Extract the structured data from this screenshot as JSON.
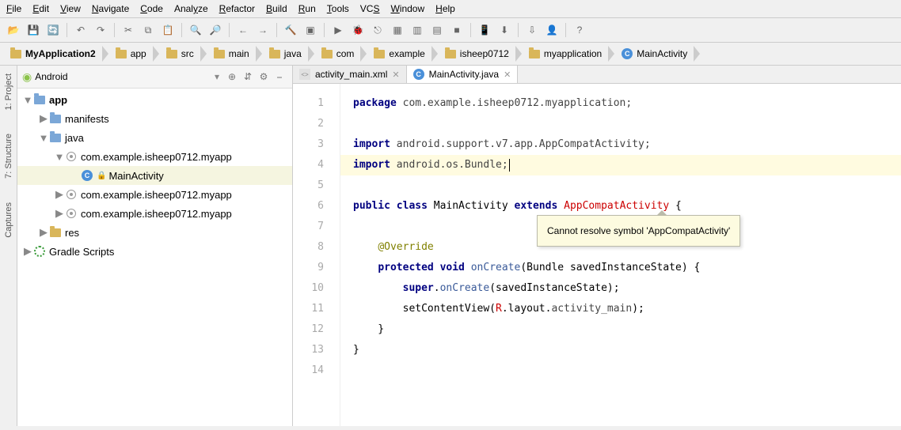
{
  "menu": [
    "File",
    "Edit",
    "View",
    "Navigate",
    "Code",
    "Analyze",
    "Refactor",
    "Build",
    "Run",
    "Tools",
    "VCS",
    "Window",
    "Help"
  ],
  "menu_underline_index": [
    0,
    0,
    0,
    0,
    0,
    4,
    0,
    0,
    0,
    0,
    2,
    0,
    0
  ],
  "breadcrumb": [
    "MyApplication2",
    "app",
    "src",
    "main",
    "java",
    "com",
    "example",
    "isheep0712",
    "myapplication",
    "MainActivity"
  ],
  "sidebar": {
    "selector": "Android",
    "tree": [
      {
        "indent": 0,
        "twisty": "▼",
        "icon": "folder-blue",
        "label": "app",
        "bold": true
      },
      {
        "indent": 1,
        "twisty": "▶",
        "icon": "folder-blue",
        "label": "manifests"
      },
      {
        "indent": 1,
        "twisty": "▼",
        "icon": "folder-blue",
        "label": "java"
      },
      {
        "indent": 2,
        "twisty": "▼",
        "icon": "pkg",
        "label": "com.example.isheep0712.myapp"
      },
      {
        "indent": 3,
        "twisty": "",
        "icon": "class",
        "label": "MainActivity",
        "selected": true,
        "lock": true
      },
      {
        "indent": 2,
        "twisty": "▶",
        "icon": "pkg",
        "label": "com.example.isheep0712.myapp"
      },
      {
        "indent": 2,
        "twisty": "▶",
        "icon": "pkg",
        "label": "com.example.isheep0712.myapp"
      },
      {
        "indent": 1,
        "twisty": "▶",
        "icon": "folder",
        "label": "res"
      },
      {
        "indent": 0,
        "twisty": "▶",
        "icon": "gradle",
        "label": "Gradle Scripts"
      }
    ]
  },
  "left_rail": [
    "1: Project",
    "7: Structure",
    "Captures"
  ],
  "tabs": [
    {
      "icon": "xml",
      "label": "activity_main.xml",
      "active": false
    },
    {
      "icon": "class",
      "label": "MainActivity.java",
      "active": true
    }
  ],
  "code_lines": [
    {
      "n": 1,
      "html": "<span class='kw'>package</span> <span class='pkg'>com.example.isheep0712.myapplication;</span>"
    },
    {
      "n": 2,
      "html": ""
    },
    {
      "n": 3,
      "html": "<span class='kw'>import</span> <span class='pkg'>android.support.v7.app.AppCompatActivity;</span>"
    },
    {
      "n": 4,
      "html": "<span class='kw'>import</span> <span class='pkg'>android.os.Bundle;</span><span class='caret'></span>",
      "hl": true
    },
    {
      "n": 5,
      "html": ""
    },
    {
      "n": 6,
      "html": "<span class='kw'>public class</span> MainActivity <span class='kw'>extends</span> <span class='err'>AppCompatActivity</span> {"
    },
    {
      "n": 7,
      "html": ""
    },
    {
      "n": 8,
      "html": "    <span class='anno'>@Override</span>"
    },
    {
      "n": 9,
      "html": "    <span class='kw'>protected void</span> <span class='fn'>onCreate</span>(Bundle savedInstanceState) {"
    },
    {
      "n": 10,
      "html": "        <span class='kw'>super</span>.<span class='fn'>onCreate</span>(savedInstanceState);"
    },
    {
      "n": 11,
      "html": "        setContentView(<span class='err'>R</span>.layout.<span class='pkg'>activity_main</span>);"
    },
    {
      "n": 12,
      "html": "    }"
    },
    {
      "n": 13,
      "html": "}"
    },
    {
      "n": 14,
      "html": ""
    }
  ],
  "tooltip": "Cannot resolve symbol 'AppCompatActivity'",
  "toolbar_icons": [
    "open",
    "save",
    "sync",
    "|",
    "undo",
    "redo",
    "|",
    "cut",
    "copy",
    "paste",
    "|",
    "find",
    "replace",
    "|",
    "back",
    "fwd",
    "|",
    "build",
    "make",
    "|",
    "run",
    "debug",
    "attach",
    "stop",
    "layout",
    "monitor",
    "stop2",
    "|",
    "avd",
    "sdk",
    "|",
    "update",
    "user",
    "|",
    "help"
  ]
}
